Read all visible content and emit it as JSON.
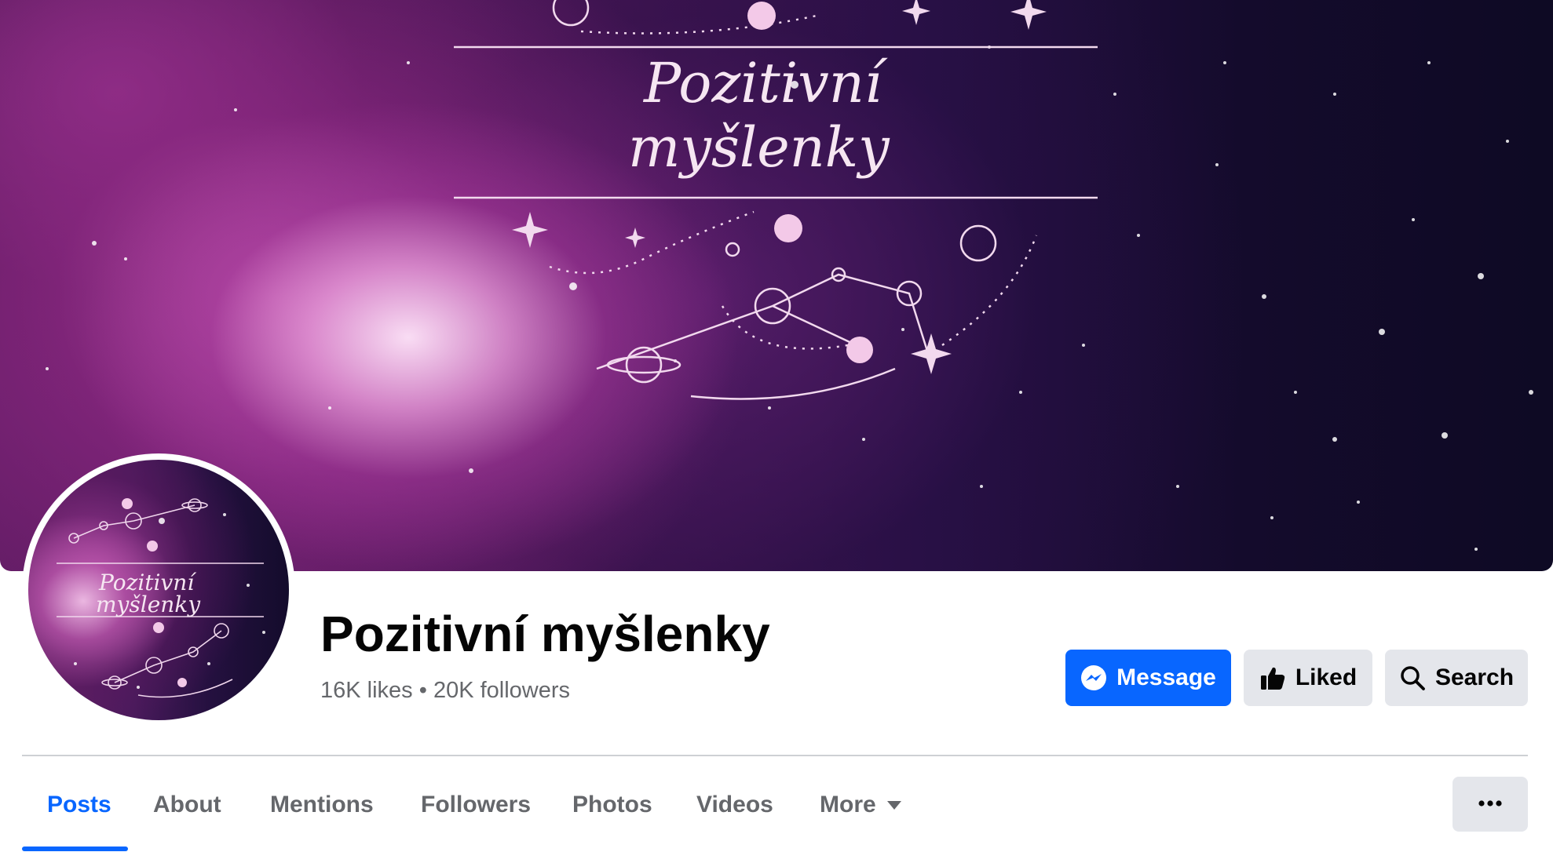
{
  "page": {
    "name": "Pozitivní myšlenky",
    "stats": "16K likes • 20K followers"
  },
  "cover": {
    "title_line1": "Pozitivní",
    "title_line2": "myšlenky"
  },
  "actions": {
    "message_label": "Message",
    "liked_label": "Liked",
    "search_label": "Search"
  },
  "tabs": [
    {
      "label": "Posts",
      "active": true
    },
    {
      "label": "About",
      "active": false
    },
    {
      "label": "Mentions",
      "active": false
    },
    {
      "label": "Followers",
      "active": false
    },
    {
      "label": "Photos",
      "active": false
    },
    {
      "label": "Videos",
      "active": false
    },
    {
      "label": "More",
      "active": false
    }
  ],
  "icons": {
    "message": "messenger-icon",
    "liked": "thumbs-up-icon",
    "search": "search-icon",
    "more": "caret-down-icon",
    "overflow": "more-dots-icon"
  },
  "colors": {
    "accent": "#0866ff",
    "secondary_button": "#e4e6eb",
    "secondary_text": "#65676b"
  }
}
